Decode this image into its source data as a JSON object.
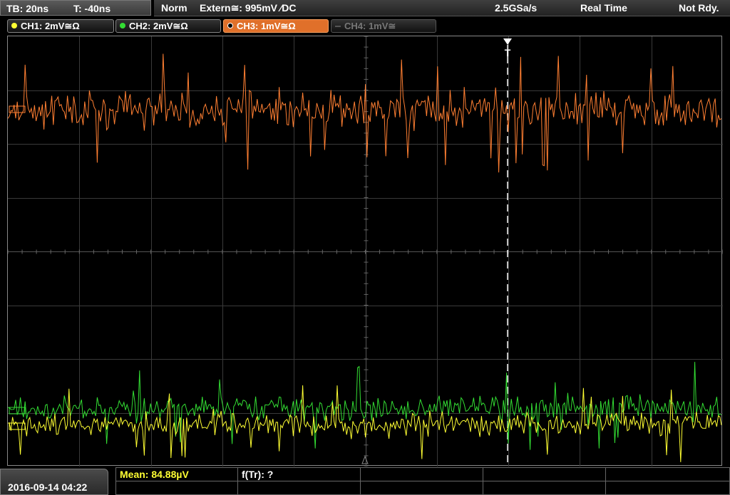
{
  "timebase": {
    "tb": "TB: 20ns",
    "t": "T: -40ns"
  },
  "status": {
    "mode": "Norm",
    "trigger": "Extern≅: 995mV ∕DC",
    "sample_rate": "2.5GSa/s",
    "acq_mode": "Real Time",
    "state": "Not Rdy."
  },
  "channels": [
    {
      "label": "CH1: 2mV≅Ω",
      "color": "#ffff33",
      "active": true
    },
    {
      "label": "CH2: 2mV≅Ω",
      "color": "#33dd33",
      "active": true
    },
    {
      "label": "CH3: 1mV≅Ω",
      "color": "#e0702a",
      "active": true
    },
    {
      "label": "CH4: 1mV≅",
      "color": "#777777",
      "active": false
    }
  ],
  "trigger_marker": "T",
  "measurements": {
    "mean": "Mean: 84.88µV",
    "freq": "f(Tr): ?"
  },
  "datetime": "2016-09-14 04:22",
  "colors": {
    "ch1": "#ffff33",
    "ch2": "#33dd33",
    "ch3": "#ff7f32",
    "grid": "#3a3a3a"
  }
}
